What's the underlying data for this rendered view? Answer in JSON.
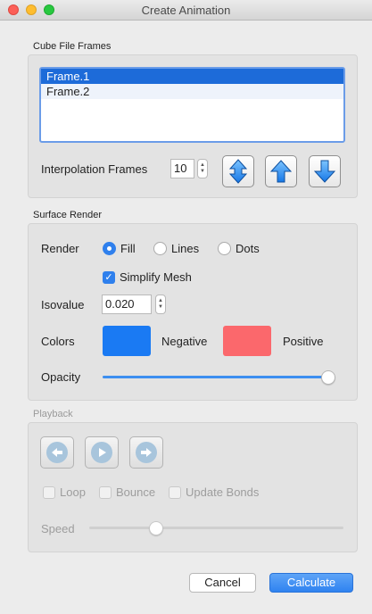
{
  "window": {
    "title": "Create Animation"
  },
  "cube_file_frames": {
    "label": "Cube File Frames",
    "frames": [
      "Frame.1",
      "Frame.2"
    ],
    "interpolation_label": "Interpolation Frames",
    "interpolation_value": "10"
  },
  "surface_render": {
    "label": "Surface Render",
    "render_label": "Render",
    "render_options": [
      "Fill",
      "Lines",
      "Dots"
    ],
    "render_selected": "Fill",
    "simplify_mesh_label": "Simplify Mesh",
    "simplify_mesh_checked": true,
    "isovalue_label": "Isovalue",
    "isovalue_value": "0.020",
    "colors_label": "Colors",
    "negative_label": "Negative",
    "negative_color": "#1a7af3",
    "positive_label": "Positive",
    "positive_color": "#fb686c",
    "opacity_label": "Opacity",
    "opacity_value": 1.0
  },
  "playback": {
    "label": "Playback",
    "enabled": false,
    "buttons": [
      "back-icon",
      "play-icon",
      "forward-icon"
    ],
    "loop_label": "Loop",
    "bounce_label": "Bounce",
    "update_bonds_label": "Update Bonds",
    "speed_label": "Speed",
    "speed_value": 0.25
  },
  "actions": {
    "cancel": "Cancel",
    "calculate": "Calculate"
  },
  "colors": {
    "accent": "#2f80ed",
    "selection": "#1d6bd9",
    "disabled_icon": "#a8c5dc"
  }
}
